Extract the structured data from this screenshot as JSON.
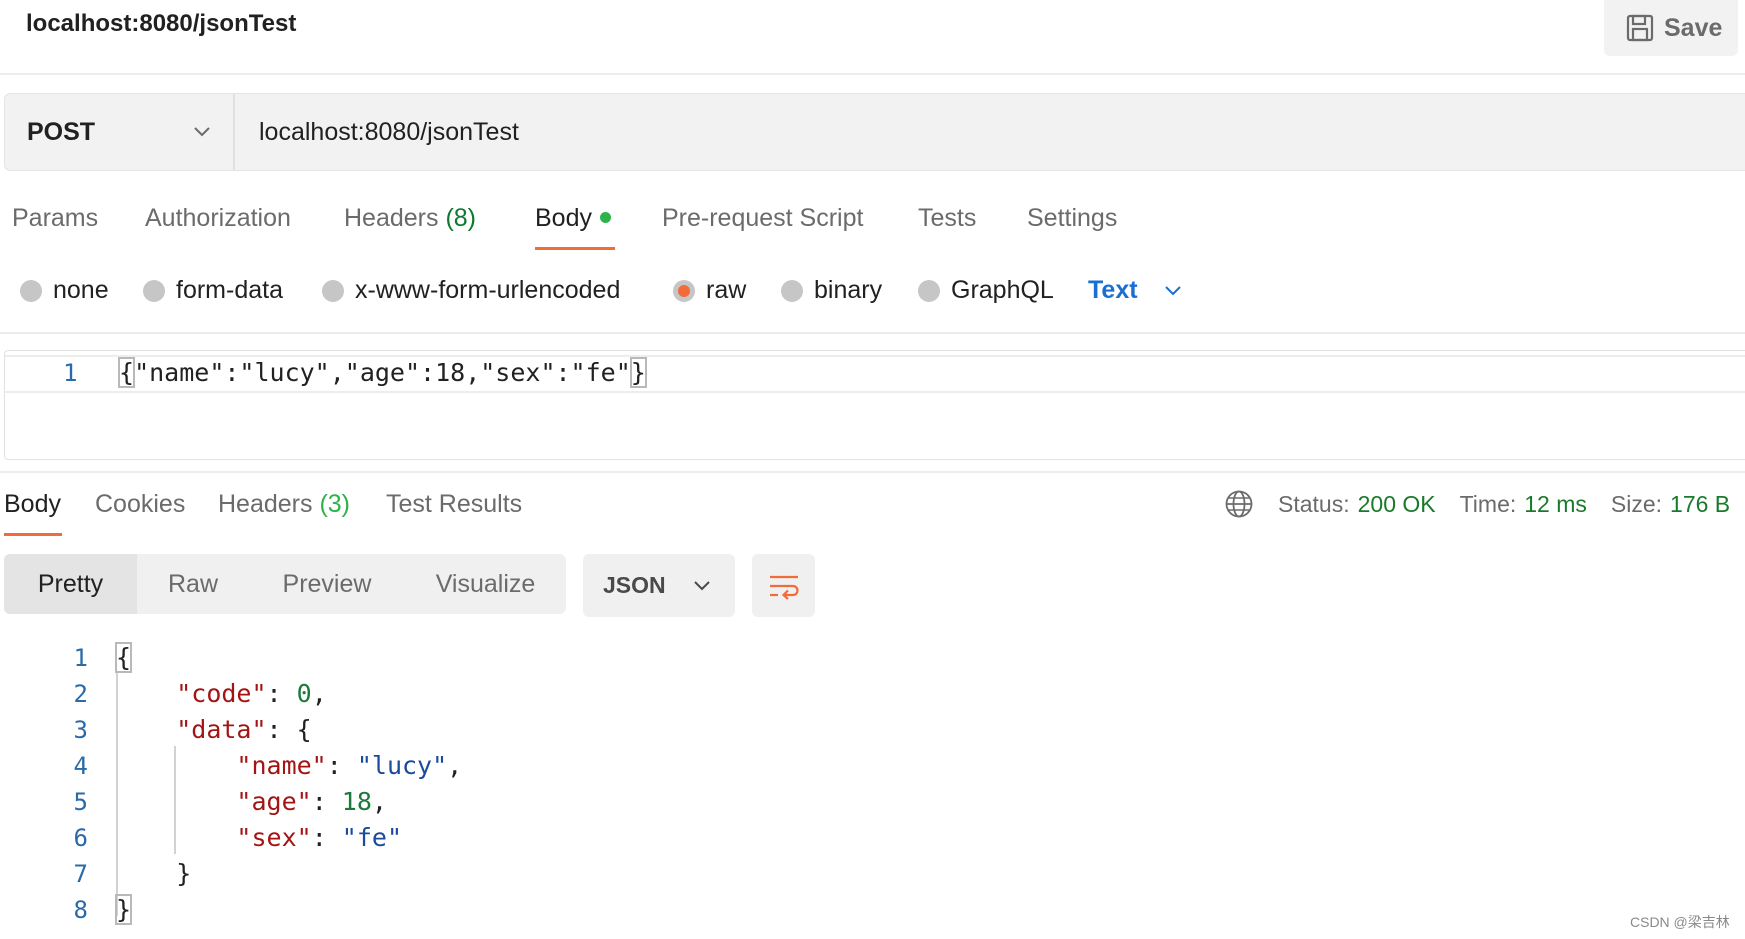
{
  "request": {
    "title": "localhost:8080/jsonTest",
    "save_label": "Save",
    "method": "POST",
    "url": "localhost:8080/jsonTest"
  },
  "request_tabs": {
    "params": "Params",
    "authorization": "Authorization",
    "headers": "Headers",
    "headers_count": "(8)",
    "body": "Body",
    "prerequest": "Pre-request Script",
    "tests": "Tests",
    "settings": "Settings"
  },
  "body_types": {
    "none": "none",
    "form_data": "form-data",
    "urlencoded": "x-www-form-urlencoded",
    "raw": "raw",
    "binary": "binary",
    "graphql": "GraphQL",
    "selected": "raw",
    "language": "Text"
  },
  "request_body": {
    "line_number": "1",
    "open": "{",
    "content": "\"name\":\"lucy\",\"age\":18,\"sex\":\"fe\"",
    "close": "}"
  },
  "response_tabs": {
    "body": "Body",
    "cookies": "Cookies",
    "headers": "Headers",
    "headers_count": "(3)",
    "test_results": "Test Results"
  },
  "status": {
    "status_label": "Status:",
    "status_value": "200 OK",
    "time_label": "Time:",
    "time_value": "12 ms",
    "size_label": "Size:",
    "size_value": "176 B"
  },
  "response_view": {
    "pretty": "Pretty",
    "raw": "Raw",
    "preview": "Preview",
    "visualize": "Visualize",
    "format": "JSON"
  },
  "response_body": {
    "line_numbers": [
      "1",
      "2",
      "3",
      "4",
      "5",
      "6",
      "7",
      "8"
    ],
    "code_key": "\"code\"",
    "code_value": "0",
    "data_key": "\"data\"",
    "name_key": "\"name\"",
    "name_value": "\"lucy\"",
    "age_key": "\"age\"",
    "age_value": "18",
    "sex_key": "\"sex\"",
    "sex_value": "\"fe\""
  },
  "watermark": "CSDN @梁吉林",
  "colors": {
    "accent": "#f26b3a",
    "success": "#2db34a",
    "link": "#1a6fd1"
  }
}
